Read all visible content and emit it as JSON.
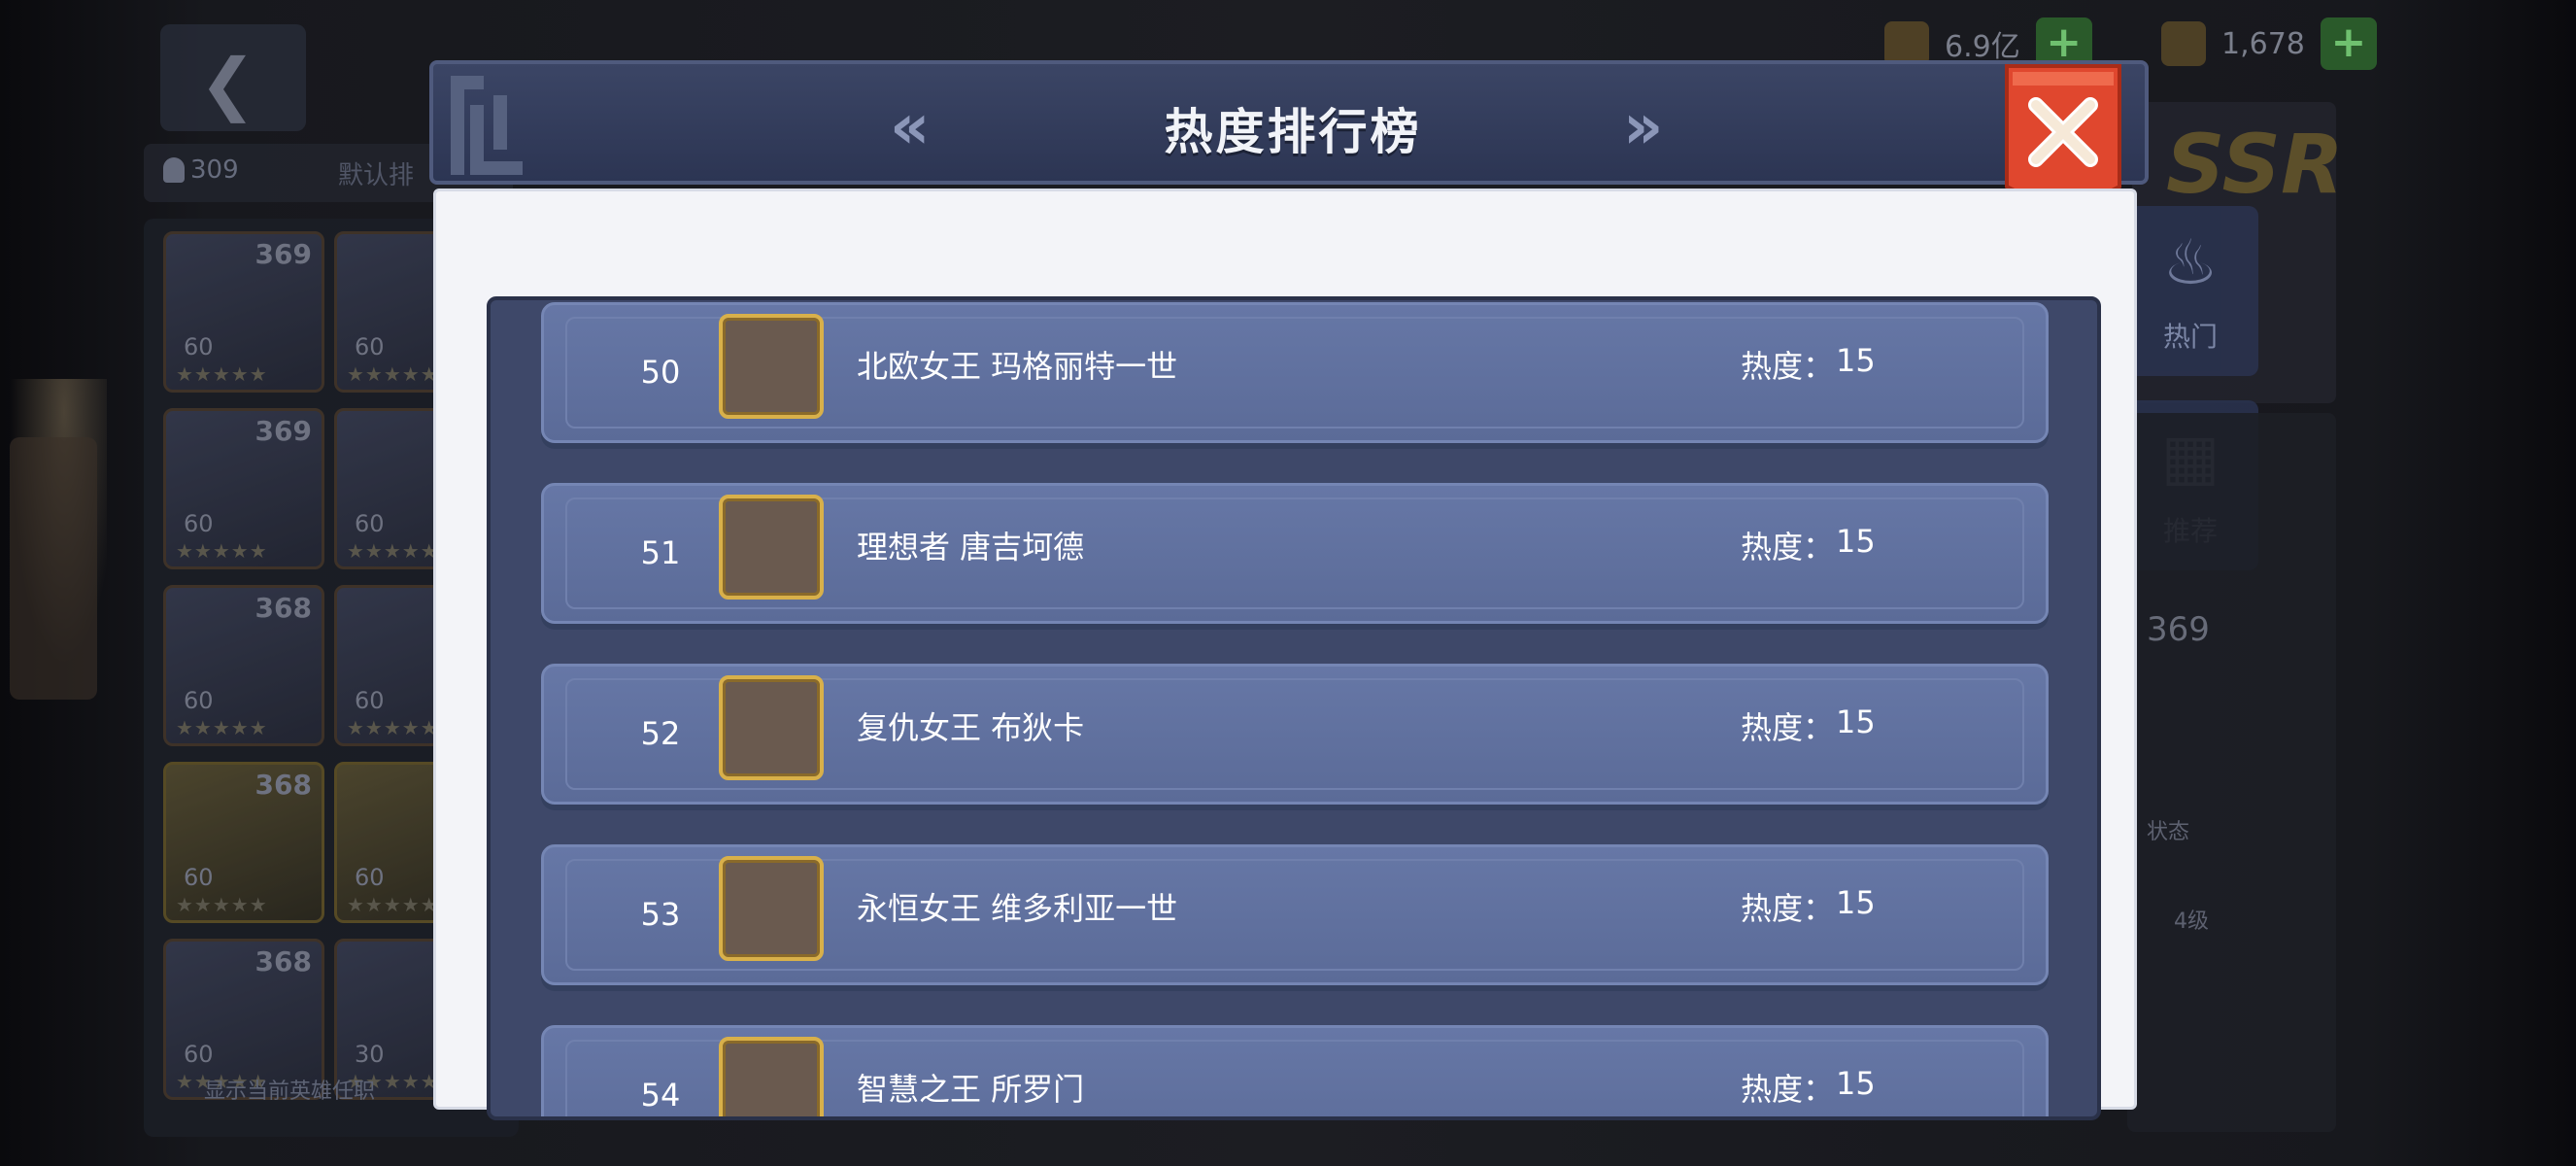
{
  "background": {
    "filter_bar": {
      "count": "309",
      "sort_label": "默认排"
    },
    "hero_cards": [
      {
        "level": "369",
        "sub": "60"
      },
      {
        "level": "",
        "sub": "60"
      },
      {
        "level": "369",
        "sub": "60"
      },
      {
        "level": "",
        "sub": "60"
      },
      {
        "level": "368",
        "sub": "60"
      },
      {
        "level": "",
        "sub": "60"
      },
      {
        "level": "368",
        "sub": "60"
      },
      {
        "level": "",
        "sub": "60"
      },
      {
        "level": "368",
        "sub": "60"
      },
      {
        "level": "",
        "sub": "30"
      }
    ],
    "footer_text": "显示当前英雄任职",
    "resources": {
      "gold": "6.9亿",
      "gems": "1,678"
    },
    "ssr_label": "SSR",
    "side_tabs": {
      "hot": "热门",
      "recommend": "推荐"
    },
    "score": "369",
    "status_label": "状态",
    "level_label": "4级"
  },
  "modal": {
    "title": "热度排行榜",
    "prev_arrow": "«",
    "next_arrow": "»",
    "close_icon": "close-icon",
    "heat_label": "热度：",
    "rows": [
      {
        "rank": "50",
        "name": "北欧女王 玛格丽特一世",
        "heat": "15"
      },
      {
        "rank": "51",
        "name": "理想者 唐吉坷德",
        "heat": "15"
      },
      {
        "rank": "52",
        "name": "复仇女王 布狄卡",
        "heat": "15"
      },
      {
        "rank": "53",
        "name": "永恒女王 维多利亚一世",
        "heat": "15"
      },
      {
        "rank": "54",
        "name": "智慧之王 所罗门",
        "heat": "15"
      }
    ]
  },
  "colors": {
    "close_button": "#e0472e",
    "row_bg": "#6273a2",
    "avatar_border": "#d8b04a"
  }
}
